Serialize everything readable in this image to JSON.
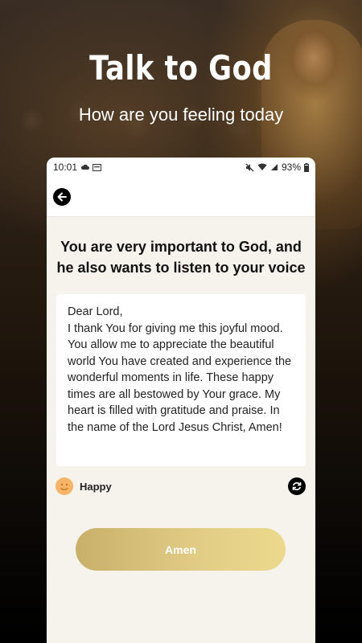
{
  "hero": {
    "title": "Talk to God",
    "subtitle": "How are you feeling today"
  },
  "status_bar": {
    "time": "10:01",
    "battery": "93%"
  },
  "headline": "You are very important to God, and he also wants to listen to your voice",
  "prayer_text": "Dear Lord,\nI thank You for giving me this joyful mood. You allow me to appreciate the beautiful world You have created and experience the wonderful moments in life. These happy times are all bestowed by Your grace. My heart is filled with gratitude and praise. In the name of the Lord Jesus Christ, Amen!",
  "mood": {
    "label": "Happy",
    "icon": "smiley-face-icon"
  },
  "amen_button": "Amen",
  "colors": {
    "accent_gold": "#d9c37a",
    "card_bg": "#f5f3ec"
  }
}
